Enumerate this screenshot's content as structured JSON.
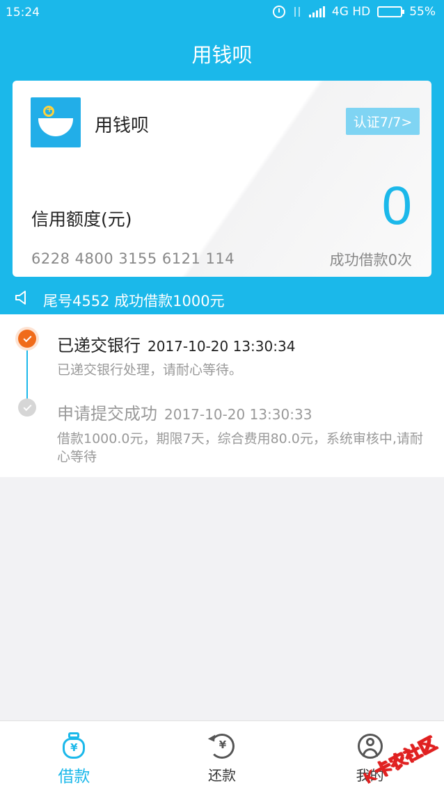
{
  "status_bar": {
    "time": "15:24",
    "network": "4G HD",
    "battery": "55%",
    "battery_level": 0.55
  },
  "header": {
    "title": "用钱呗"
  },
  "card": {
    "app_name": "用钱呗",
    "cert_label": "认证7/7>",
    "credit_label": "信用额度(元)",
    "credit_value": "0",
    "card_number": "6228 4800 3155 6121 114",
    "borrow_count": "成功借款0次"
  },
  "notice": {
    "text": "尾号4552 成功借款1000元"
  },
  "timeline": {
    "items": [
      {
        "title": "已递交银行",
        "time": "2017-10-20 13:30:34",
        "desc": "已递交银行处理，请耐心等待。"
      },
      {
        "title": "申请提交成功",
        "time": "2017-10-20 13:30:33",
        "desc": "借款1000.0元，期限7天，综合费用80.0元，系统审核中,请耐心等待"
      }
    ]
  },
  "bottom_nav": {
    "items": [
      {
        "label": "借款",
        "icon": "money-bag-icon"
      },
      {
        "label": "还款",
        "icon": "repay-icon"
      },
      {
        "label": "我的",
        "icon": "user-icon"
      }
    ]
  },
  "watermark": {
    "text": "卡农社区"
  },
  "colors": {
    "brand": "#1bb8ea",
    "accent_orange": "#f06b1a",
    "background": "#f2f2f4"
  }
}
